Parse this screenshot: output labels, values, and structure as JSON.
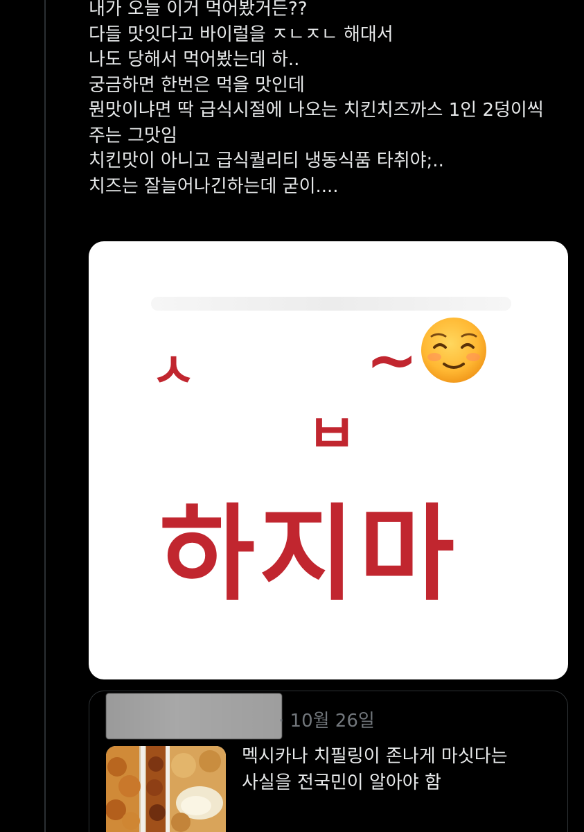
{
  "tweet": {
    "lines": [
      "내가 오늘 이거 먹어봤거든??",
      "다들 맛잇다고 바이럴을 ㅈㄴㅈㄴ 해대서",
      "나도 당해서 먹어봤는데 하..",
      "궁금하면 한번은 먹을 맛인데",
      "뭔맛이냐면 딱 급식시절에 나오는 치킨치즈까스 1인 2덩이씩",
      "주는 그맛임",
      "치킨맛이 아니고 급식퀄리티 냉동식품 타취야;..",
      "치즈는 잘늘어나긴하는데 굳이...."
    ]
  },
  "media": {
    "watermark_text": "",
    "jamo_s": "ㅅ",
    "tilde": "~",
    "jamo_b": "ㅂ",
    "emoji_icon": "smiling-face-with-smiling-eyes-icon",
    "big_text": "하지마",
    "accent_color": "#c1262f"
  },
  "quoted_tweet": {
    "date": "· 10월 26일",
    "lines": [
      "멕시카나 치필링이 존나게 마싯다는",
      "사실을 전국민이 알아야 함"
    ]
  }
}
